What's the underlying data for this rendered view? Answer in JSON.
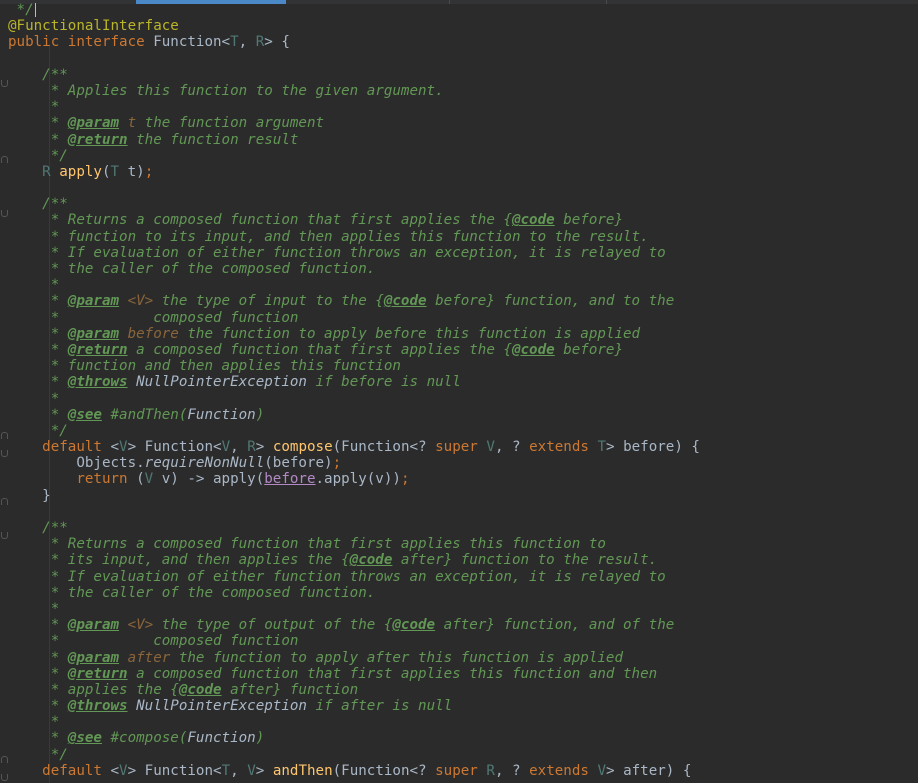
{
  "editor": {
    "language": "java",
    "colors": {
      "background": "#2b2b2b",
      "doc_comment": "#629755",
      "keyword": "#cc7832",
      "annotation": "#bbb529",
      "type_param": "#507874",
      "method_decl": "#ffc66d",
      "text": "#a9b7c6",
      "tab_active": "#4a88c7"
    },
    "lines": [
      {
        "id": "l0",
        "segs": [
          [
            "doc",
            " */"
          ]
        ],
        "caret": true
      },
      {
        "id": "l1",
        "segs": [
          [
            "ann",
            "@FunctionalInterface"
          ]
        ]
      },
      {
        "id": "l2",
        "segs": [
          [
            "kw",
            "public interface "
          ],
          [
            "plain",
            "Function<"
          ],
          [
            "tv",
            "T"
          ],
          [
            "plain",
            ", "
          ],
          [
            "tv",
            "R"
          ],
          [
            "plain",
            "> {"
          ]
        ]
      },
      {
        "id": "l3",
        "segs": []
      },
      {
        "id": "l4",
        "segs": [
          [
            "doc",
            "    /**"
          ]
        ]
      },
      {
        "id": "l5",
        "segs": [
          [
            "doc",
            "     * Applies this function to the given argument."
          ]
        ]
      },
      {
        "id": "l6",
        "segs": [
          [
            "doc",
            "     *"
          ]
        ]
      },
      {
        "id": "l7",
        "segs": [
          [
            "doc",
            "     * "
          ],
          [
            "tag",
            "@param"
          ],
          [
            "doc",
            " "
          ],
          [
            "tparam",
            "t"
          ],
          [
            "doc",
            " the function argument"
          ]
        ]
      },
      {
        "id": "l8",
        "segs": [
          [
            "doc",
            "     * "
          ],
          [
            "tag",
            "@return"
          ],
          [
            "doc",
            " the function result"
          ]
        ]
      },
      {
        "id": "l9",
        "segs": [
          [
            "doc",
            "     */"
          ]
        ]
      },
      {
        "id": "l10",
        "segs": [
          [
            "plain",
            "    "
          ],
          [
            "tv",
            "R "
          ],
          [
            "fn",
            "apply"
          ],
          [
            "plain",
            "("
          ],
          [
            "tv",
            "T "
          ],
          [
            "plain",
            "t)"
          ],
          [
            "semi",
            ";"
          ]
        ]
      },
      {
        "id": "l11",
        "segs": []
      },
      {
        "id": "l12",
        "segs": [
          [
            "doc",
            "    /**"
          ]
        ]
      },
      {
        "id": "l13",
        "segs": [
          [
            "doc",
            "     * Returns a composed function that first applies the {"
          ],
          [
            "tag",
            "@code"
          ],
          [
            "doc",
            " before}"
          ]
        ]
      },
      {
        "id": "l14",
        "segs": [
          [
            "doc",
            "     * function to its input, and then applies this function to the result."
          ]
        ]
      },
      {
        "id": "l15",
        "segs": [
          [
            "doc",
            "     * If evaluation of either function throws an exception, it is relayed to"
          ]
        ]
      },
      {
        "id": "l16",
        "segs": [
          [
            "doc",
            "     * the caller of the composed function."
          ]
        ]
      },
      {
        "id": "l17",
        "segs": [
          [
            "doc",
            "     *"
          ]
        ]
      },
      {
        "id": "l18",
        "segs": [
          [
            "doc",
            "     * "
          ],
          [
            "tag",
            "@param"
          ],
          [
            "doc",
            " "
          ],
          [
            "tparam",
            "<V>"
          ],
          [
            "doc",
            " the type of input to the {"
          ],
          [
            "tag",
            "@code"
          ],
          [
            "doc",
            " before} function, and to the"
          ]
        ]
      },
      {
        "id": "l19",
        "segs": [
          [
            "doc",
            "     *           composed function"
          ]
        ]
      },
      {
        "id": "l20",
        "segs": [
          [
            "doc",
            "     * "
          ],
          [
            "tag",
            "@param"
          ],
          [
            "doc",
            " "
          ],
          [
            "tparam",
            "before"
          ],
          [
            "doc",
            " the function to apply before this function is applied"
          ]
        ]
      },
      {
        "id": "l21",
        "segs": [
          [
            "doc",
            "     * "
          ],
          [
            "tag",
            "@return"
          ],
          [
            "doc",
            " a composed function that first applies the {"
          ],
          [
            "tag",
            "@code"
          ],
          [
            "doc",
            " before}"
          ]
        ]
      },
      {
        "id": "l22",
        "segs": [
          [
            "doc",
            "     * function and then applies this function"
          ]
        ]
      },
      {
        "id": "l23",
        "segs": [
          [
            "doc",
            "     * "
          ],
          [
            "tag",
            "@throws"
          ],
          [
            "doc",
            " "
          ],
          [
            "ref",
            "NullPointerException"
          ],
          [
            "doc",
            " if before is null"
          ]
        ]
      },
      {
        "id": "l24",
        "segs": [
          [
            "doc",
            "     *"
          ]
        ]
      },
      {
        "id": "l25",
        "segs": [
          [
            "doc",
            "     * "
          ],
          [
            "tag",
            "@see"
          ],
          [
            "doc",
            " #andThen("
          ],
          [
            "ref",
            "Function"
          ],
          [
            "doc",
            ")"
          ]
        ]
      },
      {
        "id": "l26",
        "segs": [
          [
            "doc",
            "     */"
          ]
        ]
      },
      {
        "id": "l27",
        "segs": [
          [
            "kw",
            "    default "
          ],
          [
            "plain",
            "<"
          ],
          [
            "tv",
            "V"
          ],
          [
            "plain",
            "> Function<"
          ],
          [
            "tv",
            "V"
          ],
          [
            "plain",
            ", "
          ],
          [
            "tv",
            "R"
          ],
          [
            "plain",
            "> "
          ],
          [
            "fn",
            "compose"
          ],
          [
            "plain",
            "(Function<? "
          ],
          [
            "kw",
            "super "
          ],
          [
            "tv",
            "V"
          ],
          [
            "plain",
            ", ? "
          ],
          [
            "kw",
            "extends "
          ],
          [
            "tv",
            "T"
          ],
          [
            "plain",
            "> before) {"
          ]
        ]
      },
      {
        "id": "l28",
        "segs": [
          [
            "plain",
            "        Objects."
          ],
          [
            "meth",
            "requireNonNull"
          ],
          [
            "plain",
            "(before)"
          ],
          [
            "semi",
            ";"
          ]
        ]
      },
      {
        "id": "l29",
        "segs": [
          [
            "kw",
            "        return "
          ],
          [
            "plain",
            "("
          ],
          [
            "tv",
            "V "
          ],
          [
            "plain",
            "v) -> apply("
          ],
          [
            "param-ul",
            "before"
          ],
          [
            "plain",
            ".apply(v))"
          ],
          [
            "semi",
            ";"
          ]
        ]
      },
      {
        "id": "l30",
        "segs": [
          [
            "plain",
            "    }"
          ]
        ]
      },
      {
        "id": "l31",
        "segs": []
      },
      {
        "id": "l32",
        "segs": [
          [
            "doc",
            "    /**"
          ]
        ]
      },
      {
        "id": "l33",
        "segs": [
          [
            "doc",
            "     * Returns a composed function that first applies this function to"
          ]
        ]
      },
      {
        "id": "l34",
        "segs": [
          [
            "doc",
            "     * its input, and then applies the {"
          ],
          [
            "tag",
            "@code"
          ],
          [
            "doc",
            " after} function to the result."
          ]
        ]
      },
      {
        "id": "l35",
        "segs": [
          [
            "doc",
            "     * If evaluation of either function throws an exception, it is relayed to"
          ]
        ]
      },
      {
        "id": "l36",
        "segs": [
          [
            "doc",
            "     * the caller of the composed function."
          ]
        ]
      },
      {
        "id": "l37",
        "segs": [
          [
            "doc",
            "     *"
          ]
        ]
      },
      {
        "id": "l38",
        "segs": [
          [
            "doc",
            "     * "
          ],
          [
            "tag",
            "@param"
          ],
          [
            "doc",
            " "
          ],
          [
            "tparam",
            "<V>"
          ],
          [
            "doc",
            " the type of output of the {"
          ],
          [
            "tag",
            "@code"
          ],
          [
            "doc",
            " after} function, and of the"
          ]
        ]
      },
      {
        "id": "l39",
        "segs": [
          [
            "doc",
            "     *           composed function"
          ]
        ]
      },
      {
        "id": "l40",
        "segs": [
          [
            "doc",
            "     * "
          ],
          [
            "tag",
            "@param"
          ],
          [
            "doc",
            " "
          ],
          [
            "tparam",
            "after"
          ],
          [
            "doc",
            " the function to apply after this function is applied"
          ]
        ]
      },
      {
        "id": "l41",
        "segs": [
          [
            "doc",
            "     * "
          ],
          [
            "tag",
            "@return"
          ],
          [
            "doc",
            " a composed function that first applies this function and then"
          ]
        ]
      },
      {
        "id": "l42",
        "segs": [
          [
            "doc",
            "     * applies the {"
          ],
          [
            "tag",
            "@code"
          ],
          [
            "doc",
            " after} function"
          ]
        ]
      },
      {
        "id": "l43",
        "segs": [
          [
            "doc",
            "     * "
          ],
          [
            "tag",
            "@throws"
          ],
          [
            "doc",
            " "
          ],
          [
            "ref",
            "NullPointerException"
          ],
          [
            "doc",
            " if after is null"
          ]
        ]
      },
      {
        "id": "l44",
        "segs": [
          [
            "doc",
            "     *"
          ]
        ]
      },
      {
        "id": "l45",
        "segs": [
          [
            "doc",
            "     * "
          ],
          [
            "tag",
            "@see"
          ],
          [
            "doc",
            " #compose("
          ],
          [
            "ref",
            "Function"
          ],
          [
            "doc",
            ")"
          ]
        ]
      },
      {
        "id": "l46",
        "segs": [
          [
            "doc",
            "     */"
          ]
        ]
      },
      {
        "id": "l47",
        "segs": [
          [
            "kw",
            "    default "
          ],
          [
            "plain",
            "<"
          ],
          [
            "tv",
            "V"
          ],
          [
            "plain",
            "> Function<"
          ],
          [
            "tv",
            "T"
          ],
          [
            "plain",
            ", "
          ],
          [
            "tv",
            "V"
          ],
          [
            "plain",
            "> "
          ],
          [
            "fn",
            "andThen"
          ],
          [
            "plain",
            "(Function<? "
          ],
          [
            "kw",
            "super "
          ],
          [
            "tv",
            "R"
          ],
          [
            "plain",
            ", ? "
          ],
          [
            "kw",
            "extends "
          ],
          [
            "tv",
            "V"
          ],
          [
            "plain",
            "> after) {"
          ]
        ]
      }
    ]
  }
}
